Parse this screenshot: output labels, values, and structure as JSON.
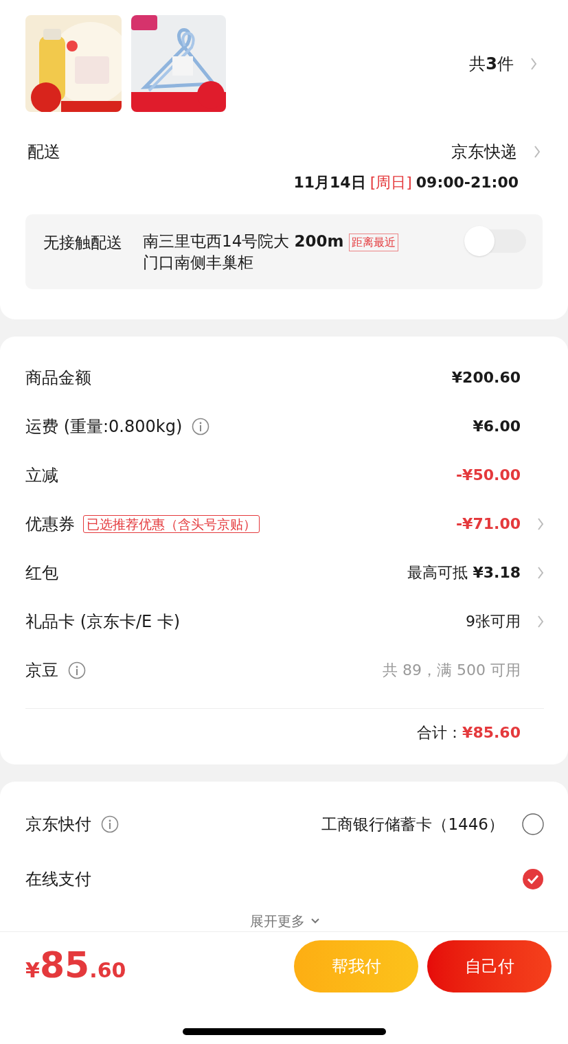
{
  "products": {
    "count": "共**3**件"
  },
  "delivery": {
    "label": "配送",
    "carrier": "京东快递",
    "date": "11月14日",
    "weekday": "[周日]",
    "time": "09:00-21:00",
    "contactless": {
      "label": "无接触配送",
      "address": "南三里屯西14号院大 **200m** 门口南侧丰巢柜",
      "tag": "距离最近",
      "on": false
    }
  },
  "summary": {
    "rows": [
      {
        "label": "商品金额",
        "value": "¥200.60",
        "kind": "bold",
        "info": false,
        "chevron": false
      },
      {
        "label": "运费 (重量:0.800kg)",
        "value": "¥6.00",
        "kind": "bold",
        "info": true,
        "chevron": false
      },
      {
        "label": "立减",
        "value": "-¥50.00",
        "kind": "red",
        "info": false,
        "chevron": false
      },
      {
        "label": "优惠券",
        "tag": "已选推荐优惠（含头号京贴）",
        "value": "-¥71.00",
        "kind": "red",
        "info": false,
        "chevron": true
      },
      {
        "label": "红包",
        "value": "最高可抵 **¥3.18**",
        "kind": "normal",
        "info": false,
        "chevron": true
      },
      {
        "label": "礼品卡 (京东卡/E 卡)",
        "value": "9张可用",
        "kind": "normal",
        "info": false,
        "chevron": true
      },
      {
        "label": "京豆",
        "value": "共 89，满 500 可用",
        "kind": "muted",
        "info": true,
        "chevron": false
      }
    ],
    "total_label": "合计：",
    "total": "¥85.60"
  },
  "payment": {
    "options": [
      {
        "label": "京东快付",
        "info": true,
        "detail": "工商银行储蓄卡（1446）",
        "selected": false
      },
      {
        "label": "在线支付",
        "info": false,
        "selected": true
      }
    ],
    "more": "展开更多"
  },
  "footer": {
    "currency": "¥",
    "amount": "85",
    "cents": ".60",
    "buttons": [
      {
        "label": "帮我付",
        "kind": "secondary"
      },
      {
        "label": "自己付",
        "kind": "primary"
      }
    ]
  }
}
